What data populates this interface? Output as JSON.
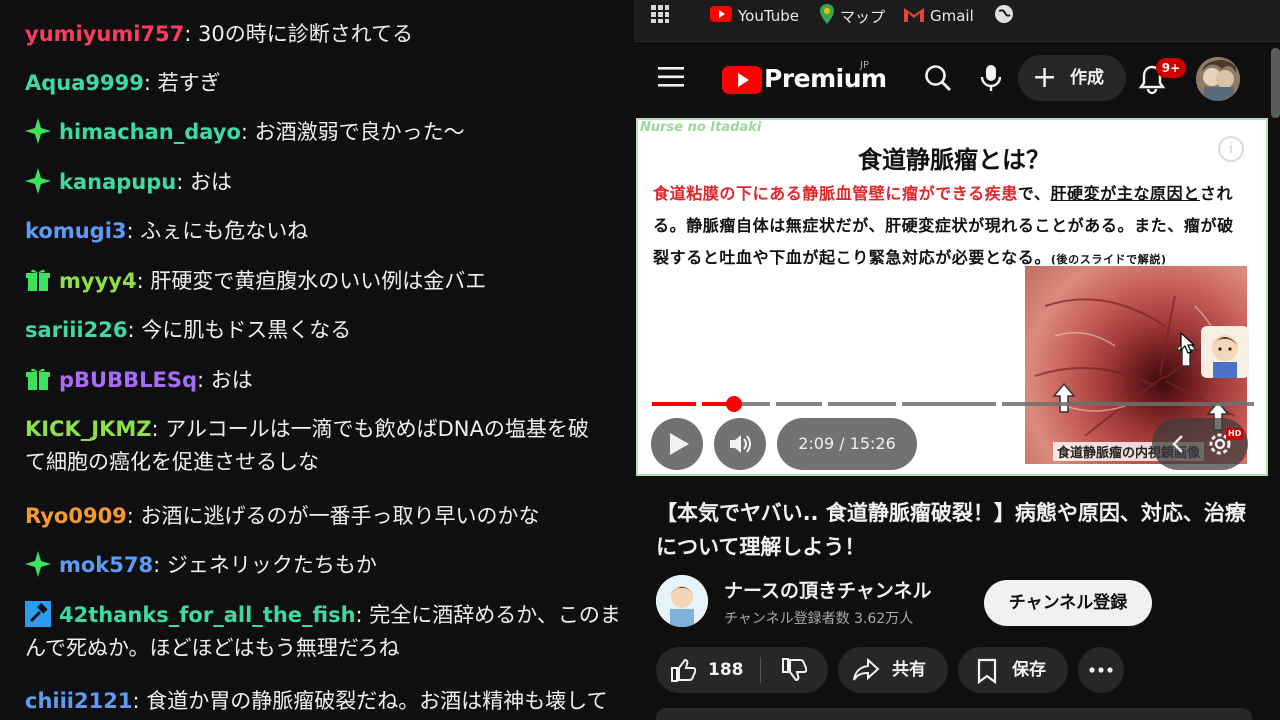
{
  "chat": {
    "messages": [
      {
        "user": "yumiyumi757",
        "color": "#ff3b5f",
        "text": ": 30の時に診断されてる",
        "badge": ""
      },
      {
        "user": "Aqua9999",
        "color": "#3fd9a3",
        "text": ": 若すぎ",
        "badge": ""
      },
      {
        "user": "himachan_dayo",
        "color": "#3fd9a3",
        "text": ": お酒激弱で良かった〜",
        "badge": "sparkle-badge-icon"
      },
      {
        "user": "kanapupu",
        "color": "#3fd9a3",
        "text": ": おは",
        "badge": "sparkle-badge-icon"
      },
      {
        "user": "komugi3",
        "color": "#5b9cf5",
        "text": ": ふぇにも危ないね",
        "badge": ""
      },
      {
        "user": "myyy4",
        "color": "#8ee04a",
        "text": ": 肝硬変で黄疸腹水のいい例は金バエ",
        "badge": "gift-badge-icon"
      },
      {
        "user": "sariii226",
        "color": "#3fd9a3",
        "text": ": 今に肌もドス黒くなる",
        "badge": ""
      },
      {
        "user": "pBUBBLESq",
        "color": "#a86cf5",
        "text": ": おは",
        "badge": "gift-badge-icon"
      },
      {
        "user": "KICK_JKMZ",
        "color": "#8ee04a",
        "text": ": アルコールは一滴でも飲めばDNAの塩基を破",
        "text2": "て細胞の癌化を促進させるしな",
        "badge": ""
      },
      {
        "user": "Ryo0909",
        "color": "#f29a2e",
        "text": ": お酒に逃げるのが一番手っ取り早いのかな",
        "badge": ""
      },
      {
        "user": "mok578",
        "color": "#5b9cf5",
        "text": ": ジェネリックたちもか",
        "badge": "sparkle-badge-icon"
      },
      {
        "user": "42thanks_for_all_the_fish",
        "color": "#3fd9a3",
        "text": ": 完全に酒辞めるか、このま",
        "text2": "んで死ぬか。ほどほどはもう無理だろね",
        "badge": "hammer-badge-icon"
      },
      {
        "user": "chiii2121",
        "color": "#5b9cf5",
        "text": ": 食道か胃の静脈瘤破裂だね。お酒は精神も壊して",
        "badge": ""
      }
    ]
  },
  "bookmarks": {
    "items": [
      {
        "label": "",
        "icon": "apps-grid-icon"
      },
      {
        "label": "YouTube",
        "icon": "youtube-icon"
      },
      {
        "label": "マップ",
        "icon": "maps-pin-icon"
      },
      {
        "label": "Gmail",
        "icon": "gmail-icon"
      },
      {
        "label": "",
        "icon": "globe-icon"
      }
    ]
  },
  "header": {
    "logo_text": "Premium",
    "region": "JP",
    "create_label": "作成",
    "notification_count": "9+"
  },
  "video": {
    "brand": "Nurse no Itadaki",
    "slide_title": "食道静脈瘤とは？",
    "slide_red": "食道粘膜の下にある静脈血管壁に瘤ができる疾患",
    "slide_text1": "で、",
    "slide_underline": "肝硬変が主な原因と",
    "slide_text2": "される。静脈瘤自体は無症状だが、肝硬変症状が現れることがある。また、瘤が破裂すると吐血や下血が起こり緊急対応が必要となる。",
    "slide_note": "(後のスライドで解説)",
    "image_caption": "食道静脈瘤の内視鏡画像",
    "time": "2:09 / 15:26",
    "progress": 0.137,
    "hd_badge": "HD"
  },
  "meta": {
    "title": "【本気でヤバい.. 食道静脈瘤破裂！】病態や原因、対応、治療について理解しよう！",
    "channel_name": "ナースの頂きチャンネル",
    "subscribers": "チャンネル登録者数 3.62万人",
    "subscribe_label": "チャンネル登録",
    "likes": "188",
    "share_label": "共有",
    "save_label": "保存"
  },
  "colors": {
    "accent_red": "#ff0000",
    "youtube_bg": "#0f0f0f",
    "pill_bg": "#272727"
  }
}
